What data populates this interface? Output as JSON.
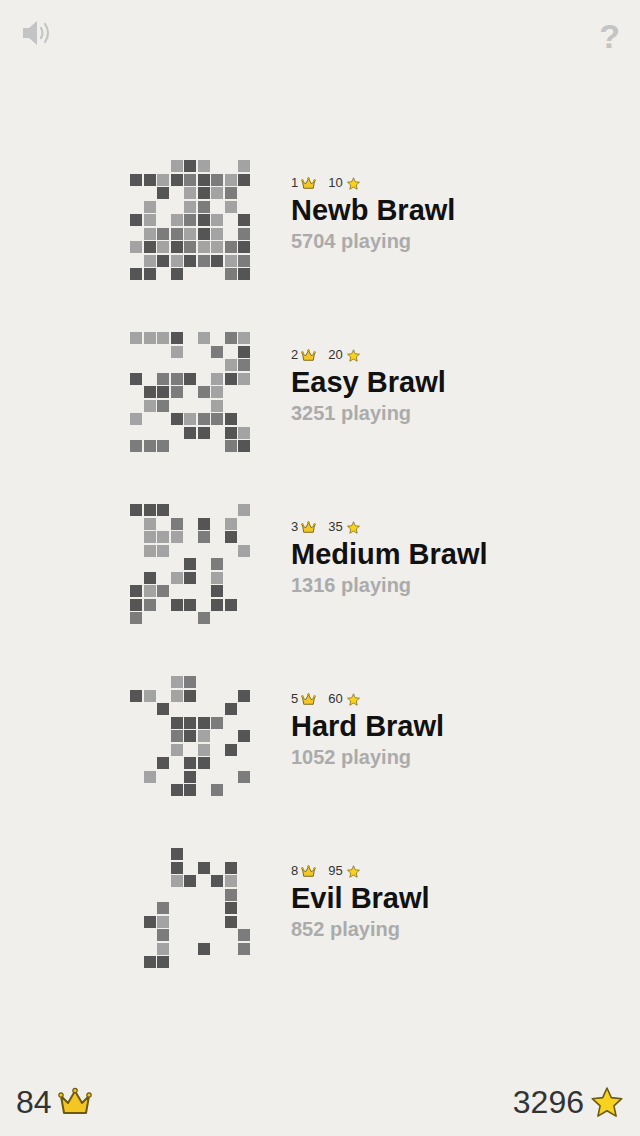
{
  "header": {
    "help": "?"
  },
  "brawls": [
    {
      "crowns": "1",
      "stars": "10",
      "title": "Newb Brawl",
      "playing": "5704 playing",
      "grid": [
        [
          0,
          0,
          0,
          1,
          3,
          1,
          0,
          0,
          1
        ],
        [
          3,
          3,
          1,
          3,
          2,
          3,
          2,
          1,
          3
        ],
        [
          0,
          0,
          3,
          0,
          1,
          3,
          1,
          2,
          0
        ],
        [
          0,
          1,
          0,
          0,
          1,
          2,
          0,
          1,
          0
        ],
        [
          3,
          1,
          0,
          1,
          2,
          3,
          1,
          0,
          3
        ],
        [
          0,
          1,
          2,
          2,
          1,
          3,
          1,
          0,
          2
        ],
        [
          1,
          3,
          1,
          3,
          2,
          1,
          1,
          2,
          3
        ],
        [
          0,
          1,
          3,
          1,
          3,
          2,
          3,
          1,
          2
        ],
        [
          3,
          3,
          0,
          3,
          0,
          0,
          0,
          2,
          3
        ]
      ]
    },
    {
      "crowns": "2",
      "stars": "20",
      "title": "Easy Brawl",
      "playing": "3251 playing",
      "grid": [
        [
          1,
          1,
          1,
          3,
          0,
          1,
          0,
          2,
          1
        ],
        [
          0,
          0,
          0,
          1,
          0,
          0,
          2,
          0,
          3
        ],
        [
          0,
          0,
          0,
          0,
          0,
          0,
          0,
          1,
          2
        ],
        [
          3,
          0,
          2,
          2,
          3,
          0,
          1,
          3,
          1
        ],
        [
          0,
          3,
          3,
          2,
          0,
          2,
          1,
          0,
          0
        ],
        [
          0,
          1,
          2,
          0,
          0,
          0,
          1,
          0,
          0
        ],
        [
          1,
          0,
          0,
          3,
          1,
          2,
          2,
          3,
          0
        ],
        [
          0,
          0,
          0,
          0,
          3,
          3,
          0,
          3,
          1
        ],
        [
          2,
          2,
          2,
          0,
          0,
          0,
          0,
          2,
          3
        ]
      ]
    },
    {
      "crowns": "3",
      "stars": "35",
      "title": "Medium Brawl",
      "playing": "1316 playing",
      "grid": [
        [
          3,
          3,
          3,
          0,
          0,
          0,
          0,
          0,
          1
        ],
        [
          0,
          1,
          0,
          2,
          0,
          3,
          0,
          1,
          0
        ],
        [
          0,
          1,
          1,
          1,
          0,
          2,
          0,
          3,
          0
        ],
        [
          0,
          1,
          1,
          0,
          0,
          0,
          0,
          0,
          1
        ],
        [
          0,
          0,
          0,
          0,
          3,
          0,
          2,
          0,
          0
        ],
        [
          0,
          3,
          0,
          1,
          3,
          0,
          1,
          0,
          0
        ],
        [
          3,
          1,
          2,
          0,
          0,
          0,
          3,
          0,
          0
        ],
        [
          3,
          2,
          0,
          3,
          3,
          0,
          3,
          3,
          0
        ],
        [
          2,
          0,
          0,
          0,
          0,
          2,
          0,
          0,
          0
        ]
      ]
    },
    {
      "crowns": "5",
      "stars": "60",
      "title": "Hard Brawl",
      "playing": "1052 playing",
      "grid": [
        [
          0,
          0,
          0,
          1,
          2,
          0,
          0,
          0,
          0
        ],
        [
          3,
          1,
          0,
          1,
          3,
          0,
          0,
          0,
          3
        ],
        [
          0,
          0,
          3,
          0,
          0,
          0,
          0,
          3,
          0
        ],
        [
          0,
          0,
          0,
          3,
          3,
          3,
          2,
          0,
          0
        ],
        [
          0,
          0,
          0,
          2,
          3,
          1,
          0,
          0,
          3
        ],
        [
          0,
          0,
          0,
          1,
          0,
          1,
          0,
          3,
          0
        ],
        [
          0,
          0,
          3,
          0,
          3,
          3,
          0,
          0,
          0
        ],
        [
          0,
          1,
          0,
          0,
          3,
          0,
          0,
          0,
          2
        ],
        [
          0,
          0,
          0,
          3,
          3,
          0,
          2,
          0,
          0
        ]
      ]
    },
    {
      "crowns": "8",
      "stars": "95",
      "title": "Evil Brawl",
      "playing": "852 playing",
      "grid": [
        [
          0,
          0,
          0,
          3,
          0,
          0,
          0,
          0,
          0
        ],
        [
          0,
          0,
          0,
          3,
          0,
          3,
          0,
          3,
          0
        ],
        [
          0,
          0,
          0,
          1,
          3,
          0,
          3,
          1,
          0
        ],
        [
          0,
          0,
          0,
          0,
          0,
          0,
          0,
          2,
          0
        ],
        [
          0,
          0,
          2,
          0,
          0,
          0,
          0,
          3,
          0
        ],
        [
          0,
          3,
          1,
          0,
          0,
          0,
          0,
          3,
          0
        ],
        [
          0,
          0,
          2,
          0,
          0,
          0,
          0,
          0,
          2
        ],
        [
          0,
          0,
          1,
          0,
          0,
          3,
          0,
          0,
          2
        ],
        [
          0,
          3,
          3,
          0,
          0,
          0,
          0,
          0,
          0
        ]
      ]
    }
  ],
  "totals": {
    "crowns": "84",
    "stars": "3296"
  }
}
